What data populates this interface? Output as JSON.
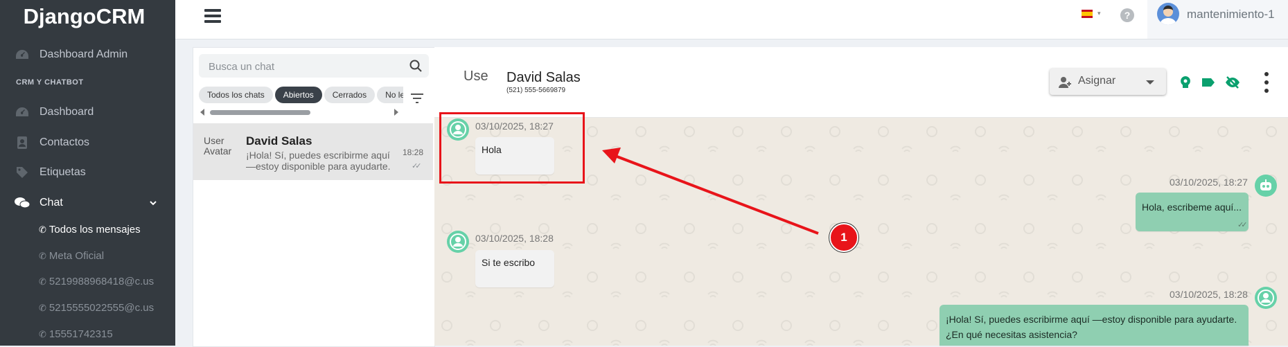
{
  "brand": "DjangoCRM",
  "sidebar": {
    "top_item": "Dashboard Admin",
    "section_header": "CRM Y CHATBOT",
    "items": [
      {
        "label": "Dashboard",
        "icon": "dashboard-gauge-icon"
      },
      {
        "label": "Contactos",
        "icon": "address-book-icon"
      },
      {
        "label": "Etiquetas",
        "icon": "tag-icon"
      },
      {
        "label": "Chat",
        "icon": "chat-bubbles-icon"
      }
    ],
    "chat_subitems": [
      "Todos los mensajes",
      "Meta Oficial",
      "5219988968418@c.us",
      "5215555022555@c.us",
      "15551742315"
    ]
  },
  "topbar": {
    "username": "mantenimiento-1",
    "language_flag": "es"
  },
  "chatlist": {
    "search_placeholder": "Busca un chat",
    "filters": [
      "Todos los chats",
      "Abiertos",
      "Cerrados",
      "No leídos"
    ],
    "active_filter": "Abiertos",
    "chats": [
      {
        "avatar_alt": "User Avatar",
        "name": "David Salas",
        "preview": "¡Hola! Sí, puedes escribirme aquí —estoy disponible para ayudarte. ¿En qué necesitas asistencia?",
        "time": "18:28"
      }
    ]
  },
  "conversation": {
    "avatar_alt": "User",
    "name": "David Salas",
    "phone": "(521) 555-5669879",
    "assign_label": "Asignar",
    "messages": [
      {
        "direction": "in",
        "time": "03/10/2025, 18:27",
        "text": "Hola"
      },
      {
        "direction": "out",
        "time": "03/10/2025, 18:27",
        "text": "Hola, escribeme aquí..."
      },
      {
        "direction": "in",
        "time": "03/10/2025, 18:28",
        "text": "Si te escribo"
      },
      {
        "direction": "out",
        "time": "03/10/2025, 18:28",
        "text_line1": "¡Hola! Sí, puedes escribirme aquí —estoy disponible para ayudarte.",
        "text_line2": "¿En qué necesitas asistencia?"
      }
    ]
  },
  "annotation": {
    "marker_label": "1",
    "color": "#e8141a"
  }
}
